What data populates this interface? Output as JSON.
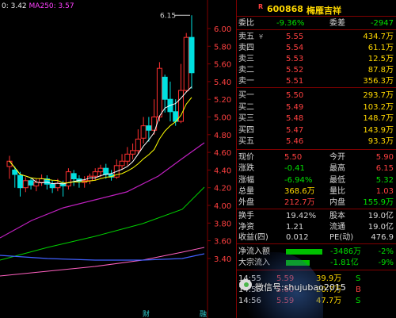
{
  "chart": {
    "ma_legend": {
      "ma1": "0: 3.42",
      "ma250": "MA250: 3.57"
    },
    "price_axis": [
      "6.00",
      "5.80",
      "5.60",
      "5.40",
      "5.20",
      "5.00",
      "4.80",
      "4.60",
      "4.40",
      "4.20",
      "4.00",
      "3.80",
      "3.60",
      "3.40"
    ],
    "high_marker": "6.15",
    "bottom_labels": {
      "left": "财",
      "right": "融"
    },
    "colors": {
      "up": "#ff3030",
      "down": "#00e0e0",
      "ma_white": "#ffffff",
      "ma_yellow": "#ffff00",
      "ma_magenta": "#c020c0",
      "ma_green": "#00d000",
      "ma_blue": "#4060ff",
      "ma_pink": "#ff60c0"
    }
  },
  "stock": {
    "flag": "R",
    "code": "600868",
    "name": "梅雁吉祥"
  },
  "quote": {
    "weibi": {
      "label": "委比",
      "value": "-9.36%",
      "label2": "委差",
      "value2": "-2947"
    },
    "asks": [
      {
        "label": "卖五",
        "mark": "¥",
        "price": "5.55",
        "vol": "434.7万"
      },
      {
        "label": "卖四",
        "price": "5.54",
        "vol": "61.1万"
      },
      {
        "label": "卖三",
        "price": "5.53",
        "vol": "12.5万"
      },
      {
        "label": "卖二",
        "price": "5.52",
        "vol": "87.8万"
      },
      {
        "label": "卖一",
        "price": "5.51",
        "vol": "356.3万"
      }
    ],
    "bids": [
      {
        "label": "买一",
        "price": "5.50",
        "vol": "293.7万"
      },
      {
        "label": "买二",
        "price": "5.49",
        "vol": "103.2万"
      },
      {
        "label": "买三",
        "price": "5.48",
        "vol": "148.7万"
      },
      {
        "label": "买四",
        "price": "5.47",
        "vol": "143.9万"
      },
      {
        "label": "买五",
        "price": "5.46",
        "vol": "93.3万"
      }
    ],
    "stats": [
      {
        "l1": "现价",
        "v1": "5.50",
        "l2": "今开",
        "v2": "5.90"
      },
      {
        "l1": "涨跌",
        "v1": "-0.41",
        "l2": "最高",
        "v2": "6.15"
      },
      {
        "l1": "涨幅",
        "v1": "-6.94%",
        "l2": "最低",
        "v2": "5.32"
      },
      {
        "l1": "总量",
        "v1": "368.6万",
        "l2": "量比",
        "v2": "1.03"
      },
      {
        "l1": "外盘",
        "v1": "212.7万",
        "l2": "内盘",
        "v2": "155.9万"
      }
    ],
    "stats2": [
      {
        "l1": "换手",
        "v1": "19.42%",
        "l2": "股本",
        "v2": "19.0亿"
      },
      {
        "l1": "净资",
        "v1": "1.21",
        "l2": "流通",
        "v2": "19.0亿"
      },
      {
        "l1": "收益(四)",
        "v1": "0.012",
        "l2": "PE(动)",
        "v2": "476.9"
      }
    ],
    "flows": [
      {
        "label": "净流入额",
        "value": "-3486万",
        "pct": "-2%"
      },
      {
        "label": "大宗流入",
        "value": "-1.81亿",
        "pct": "-9%"
      }
    ],
    "ticks": [
      {
        "time": "14:55",
        "price": "5.59",
        "vol": "39.9万",
        "side": "S"
      },
      {
        "time": "14:55",
        "price": "5.60",
        "vol": "20.7万",
        "side": "B"
      },
      {
        "time": "14:56",
        "price": "5.59",
        "vol": "47.7万",
        "side": "S"
      }
    ]
  },
  "watermark": "微信号:shujubao2015"
}
